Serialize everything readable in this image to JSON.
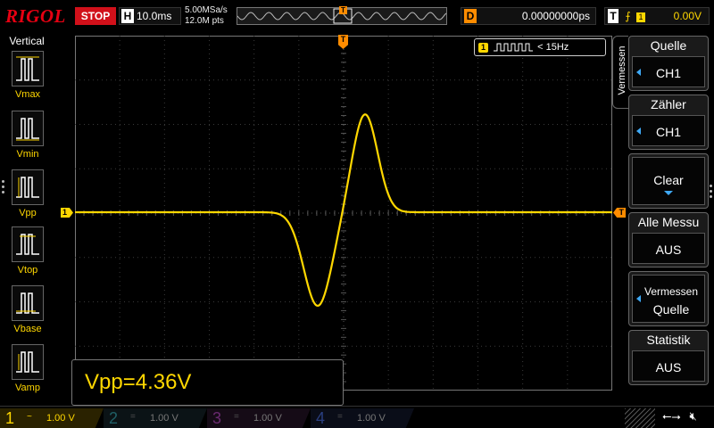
{
  "header": {
    "logo": "RIGOL",
    "run_state": "STOP",
    "horizontal": {
      "letter": "H",
      "timebase": "10.0ms"
    },
    "sample_rate": "5.00MSa/s",
    "memory_depth": "12.0M pts",
    "trigger_pos_marker": "T",
    "delay": {
      "letter": "D",
      "value": "0.00000000ps"
    },
    "trigger": {
      "letter": "T",
      "edge_icon": "rising-edge-icon",
      "channel": "1",
      "level": "0.00V"
    }
  },
  "left_menu": {
    "title": "Vertical",
    "items": [
      {
        "label": "Vmax",
        "icon": "vmax-icon"
      },
      {
        "label": "Vmin",
        "icon": "vmin-icon"
      },
      {
        "label": "Vpp",
        "icon": "vpp-icon"
      },
      {
        "label": "Vtop",
        "icon": "vtop-icon"
      },
      {
        "label": "Vbase",
        "icon": "vbase-icon"
      },
      {
        "label": "Vamp",
        "icon": "vamp-icon"
      }
    ]
  },
  "display": {
    "ch1_marker": "1",
    "trigger_marker": "T",
    "trigger_level_marker": "T",
    "frequency_counter": {
      "channel": "1",
      "text": "< 15Hz"
    },
    "measurement": "Vpp=4.36V",
    "trace_color": "#ffd700"
  },
  "right_menu": {
    "tab": "Vermessen",
    "items": [
      {
        "label": "Quelle",
        "value": "CH1",
        "arrow": true
      },
      {
        "label": "Zähler",
        "value": "CH1",
        "arrow": true
      },
      {
        "label": "Clear",
        "value": "",
        "arrow": false
      },
      {
        "label": "Alle Messu",
        "value": "AUS",
        "arrow": false
      },
      {
        "label": "Vermessen",
        "value": "Quelle",
        "arrow": true
      },
      {
        "label": "Statistik",
        "value": "AUS",
        "arrow": false
      }
    ]
  },
  "footer": {
    "channels": [
      {
        "num": "1",
        "coupling": "~",
        "scale": "1.00 V",
        "color": "#ffd700"
      },
      {
        "num": "2",
        "coupling": "=",
        "scale": "1.00 V",
        "color": "#00bcd4"
      },
      {
        "num": "3",
        "coupling": "=",
        "scale": "1.00 V",
        "color": "#e040fb"
      },
      {
        "num": "4",
        "coupling": "=",
        "scale": "1.00 V",
        "color": "#2962ff"
      }
    ],
    "usb_icon": "usb-icon",
    "sound_icon": "sound-muted-icon"
  }
}
